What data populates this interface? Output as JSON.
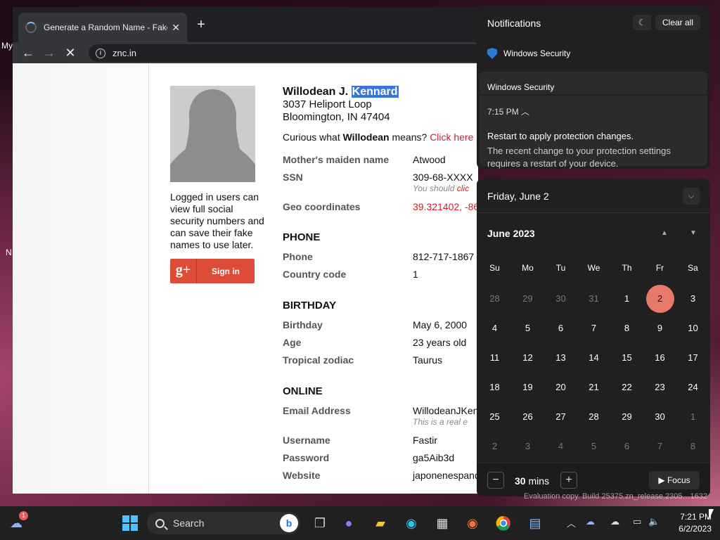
{
  "desktop": {
    "frag1": "My",
    "frag2": "N"
  },
  "browser": {
    "tab_title": "Generate a Random Name - Fake",
    "url": "znc.in"
  },
  "page": {
    "login_note": "Logged in users can view full social security numbers and can save their fake names to use later.",
    "signin_label": "Sign in",
    "name_first": "Willodean J.",
    "name_last": "Kennard",
    "street": "3037 Heliport Loop",
    "city": "Bloomington, IN 47404",
    "curious_pre": "Curious what",
    "curious_name": "Willodean",
    "curious_post": "means?",
    "curious_link": "Click here",
    "maiden_label": "Mother's maiden name",
    "maiden_value": "Atwood",
    "ssn_label": "SSN",
    "ssn_value": "309-68-XXXX",
    "ssn_note": "You should",
    "ssn_note_link": "clic",
    "geo_label": "Geo coordinates",
    "geo_value": "39.321402, -86",
    "phone_header": "PHONE",
    "phone_label": "Phone",
    "phone_value": "812-717-1867",
    "country_label": "Country code",
    "country_value": "1",
    "birthday_header": "BIRTHDAY",
    "birthday_label": "Birthday",
    "birthday_value": "May 6, 2000",
    "age_label": "Age",
    "age_value": "23 years old",
    "zodiac_label": "Tropical zodiac",
    "zodiac_value": "Taurus",
    "online_header": "ONLINE",
    "email_label": "Email Address",
    "email_value": "WillodeanJKen",
    "email_note": "This is a real e",
    "username_label": "Username",
    "username_value": "Fastir",
    "password_label": "Password",
    "password_value": "ga5Aib3d",
    "website_label": "Website",
    "website_value": "japonenespand"
  },
  "notifications": {
    "title": "Notifications",
    "clear_all": "Clear all",
    "app_name": "Windows Security",
    "card_source": "Windows Security",
    "time": "7:15 PM",
    "headline": "Restart to apply protection changes.",
    "body": "The recent change to your protection settings requires a restart of your device."
  },
  "calendar": {
    "date_header": "Friday, June 2",
    "month_label": "June 2023",
    "weekdays": [
      "Su",
      "Mo",
      "Tu",
      "We",
      "Th",
      "Fr",
      "Sa"
    ],
    "weeks": [
      [
        [
          "28",
          1
        ],
        [
          "29",
          1
        ],
        [
          "30",
          1
        ],
        [
          "31",
          1
        ],
        [
          "1",
          0
        ],
        [
          "2",
          2
        ],
        [
          "3",
          0
        ]
      ],
      [
        [
          "4",
          0
        ],
        [
          "5",
          0
        ],
        [
          "6",
          0
        ],
        [
          "7",
          0
        ],
        [
          "8",
          0
        ],
        [
          "9",
          0
        ],
        [
          "10",
          0
        ]
      ],
      [
        [
          "11",
          0
        ],
        [
          "12",
          0
        ],
        [
          "13",
          0
        ],
        [
          "14",
          0
        ],
        [
          "15",
          0
        ],
        [
          "16",
          0
        ],
        [
          "17",
          0
        ]
      ],
      [
        [
          "18",
          0
        ],
        [
          "19",
          0
        ],
        [
          "20",
          0
        ],
        [
          "21",
          0
        ],
        [
          "22",
          0
        ],
        [
          "23",
          0
        ],
        [
          "24",
          0
        ]
      ],
      [
        [
          "25",
          0
        ],
        [
          "26",
          0
        ],
        [
          "27",
          0
        ],
        [
          "28",
          0
        ],
        [
          "29",
          0
        ],
        [
          "30",
          0
        ],
        [
          "1",
          1
        ]
      ],
      [
        [
          "2",
          1
        ],
        [
          "3",
          1
        ],
        [
          "4",
          1
        ],
        [
          "5",
          1
        ],
        [
          "6",
          1
        ],
        [
          "7",
          1
        ],
        [
          "8",
          1
        ]
      ]
    ],
    "focus_minutes": "30",
    "minutes_unit": "mins",
    "focus_label": "Focus"
  },
  "watermark": "Evaluation copy. Build 25375.zn_release.2305",
  "watermark_tail": "1632",
  "taskbar": {
    "search_label": "Search",
    "notification_badge": "1",
    "time": "7:21 PM",
    "date": "6/2/2023"
  },
  "colors": {
    "accent": "#e8796a",
    "link": "#d3202e",
    "highlight": "#3875d7"
  }
}
